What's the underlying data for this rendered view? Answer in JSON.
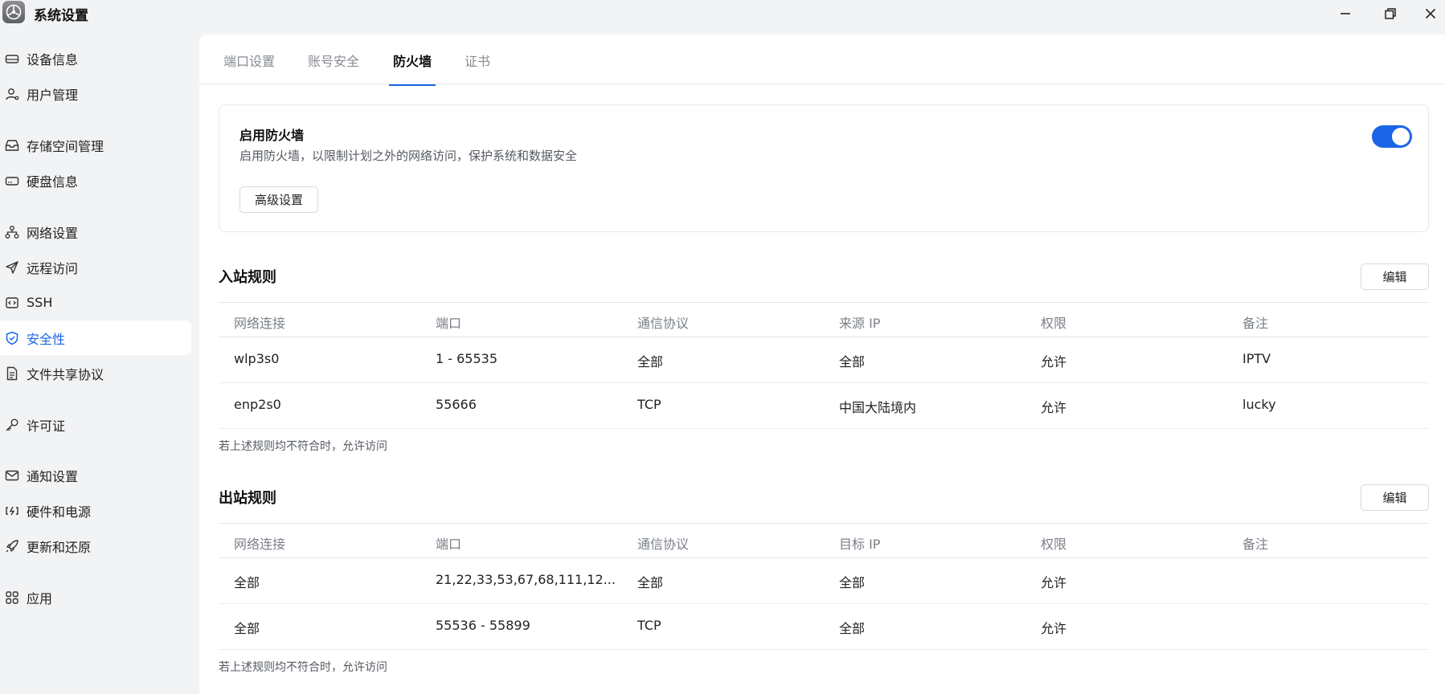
{
  "window": {
    "title": "系统设置",
    "controls": [
      "minimize-icon",
      "maximize-icon",
      "close-icon"
    ]
  },
  "sidebar": {
    "items": [
      {
        "label": "设备信息",
        "icon": "device-icon"
      },
      {
        "label": "用户管理",
        "icon": "user-icon"
      },
      {
        "label": "存储空间管理",
        "icon": "storage-icon"
      },
      {
        "label": "硬盘信息",
        "icon": "disk-icon"
      },
      {
        "label": "网络设置",
        "icon": "network-icon"
      },
      {
        "label": "远程访问",
        "icon": "send-icon"
      },
      {
        "label": "SSH",
        "icon": "ssh-icon"
      },
      {
        "label": "安全性",
        "icon": "shield-icon",
        "active": true
      },
      {
        "label": "文件共享协议",
        "icon": "document-icon"
      },
      {
        "label": "许可证",
        "icon": "key-icon"
      },
      {
        "label": "通知设置",
        "icon": "mail-icon"
      },
      {
        "label": "硬件和电源",
        "icon": "power-icon"
      },
      {
        "label": "更新和还原",
        "icon": "rocket-icon"
      },
      {
        "label": "应用",
        "icon": "apps-icon"
      }
    ]
  },
  "tabs": [
    {
      "label": "端口设置"
    },
    {
      "label": "账号安全"
    },
    {
      "label": "防火墙",
      "active": true
    },
    {
      "label": "证书"
    }
  ],
  "firewall": {
    "title": "启用防火墙",
    "description": "启用防火墙，以限制计划之外的网络访问，保护系统和数据安全",
    "advanced_button": "高级设置",
    "enabled": true
  },
  "inbound": {
    "title": "入站规则",
    "edit_button": "编辑",
    "headers": [
      "网络连接",
      "端口",
      "通信协议",
      "来源 IP",
      "权限",
      "备注"
    ],
    "rows": [
      [
        "wlp3s0",
        "1 - 65535",
        "全部",
        "全部",
        "允许",
        "IPTV"
      ],
      [
        "enp2s0",
        "55666",
        "TCP",
        "中国大陆境内",
        "允许",
        "lucky"
      ]
    ],
    "footnote": "若上述规则均不符合时，允许访问"
  },
  "outbound": {
    "title": "出站规则",
    "edit_button": "编辑",
    "headers": [
      "网络连接",
      "端口",
      "通信协议",
      "目标 IP",
      "权限",
      "备注"
    ],
    "rows": [
      [
        "全部",
        "21,22,33,53,67,68,111,12...",
        "全部",
        "全部",
        "允许",
        ""
      ],
      [
        "全部",
        "55536 - 55899",
        "TCP",
        "全部",
        "允许",
        ""
      ]
    ],
    "footnote": "若上述规则均不符合时，允许访问"
  },
  "colors": {
    "accent": "#1a66e6",
    "sidebar_bg": "#f2f3f5",
    "content_bg": "#ffffff"
  }
}
